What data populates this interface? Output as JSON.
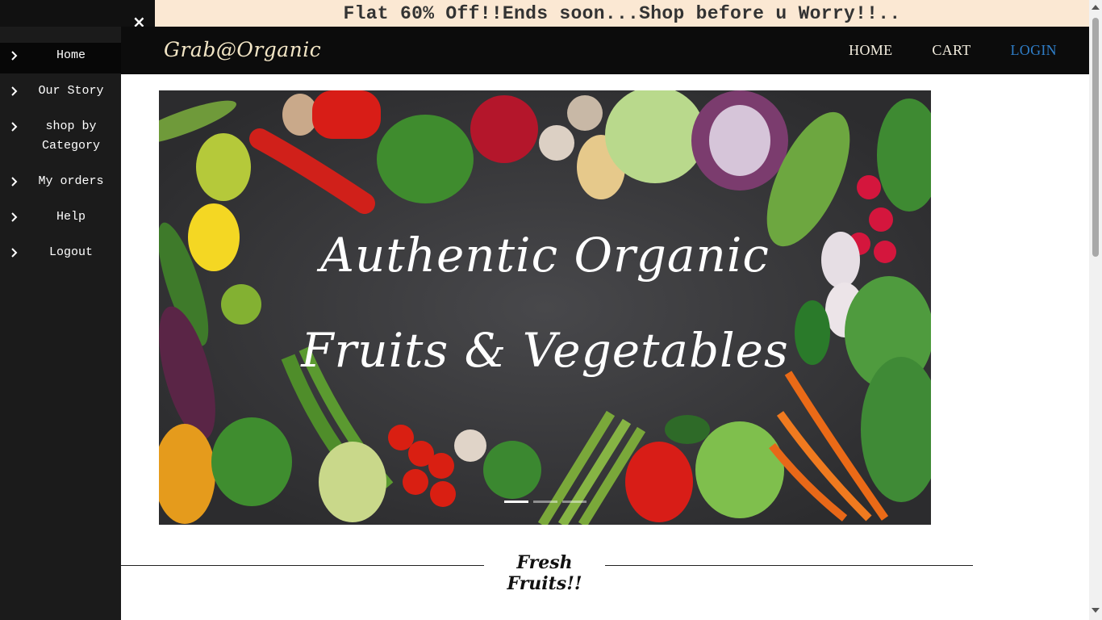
{
  "promo": {
    "text": "Flat 60% Off!!Ends soon...Shop before u Worry!!.."
  },
  "navbar": {
    "brand": "Grab@Organic",
    "links": [
      {
        "label": "HOME"
      },
      {
        "label": "CART"
      },
      {
        "label": "LOGIN",
        "color": "#2f7ec9"
      }
    ]
  },
  "sidebar": {
    "close_symbol": "×",
    "items": [
      {
        "label": "Home",
        "icon": "chevron-right-icon",
        "active": true
      },
      {
        "label": "Our Story",
        "icon": "chevron-right-icon"
      },
      {
        "label": "shop by Category",
        "icon": "chevron-right-icon"
      },
      {
        "label": "My orders",
        "icon": "chevron-right-icon"
      },
      {
        "label": "Help",
        "icon": "chevron-right-icon"
      },
      {
        "label": "Logout",
        "icon": "chevron-right-icon"
      }
    ]
  },
  "hero": {
    "line1": "Authentic Organic",
    "line2": "Fruits & Vegetables",
    "slide_count": 3,
    "active_slide": 1
  },
  "section": {
    "title": "Fresh Fruits!!"
  },
  "colors": {
    "promo_bg": "#fbe8d3",
    "navbar_bg": "#0c0c0c",
    "sidebar_bg": "#1b1b1b",
    "login_link": "#2f7ec9",
    "brand": "#f3e6c6"
  }
}
